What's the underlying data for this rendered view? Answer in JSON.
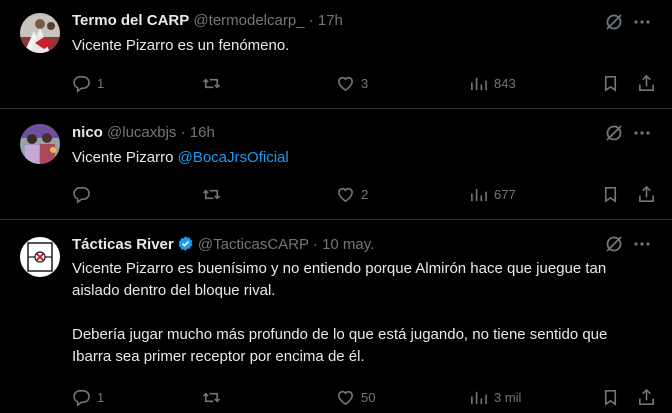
{
  "tweets": [
    {
      "name": "Termo del CARP",
      "handle": "@termodelcarp_",
      "separator": "·",
      "time": "17h",
      "text": "Vicente Pizarro es un fenómeno.",
      "replies": "1",
      "retweets": "",
      "likes": "3",
      "views": "843"
    },
    {
      "name": "nico",
      "handle": "@lucaxbjs",
      "separator": "·",
      "time": "16h",
      "text_prefix": "Vicente Pizarro ",
      "mention": "@BocaJrsOficial",
      "replies": "",
      "retweets": "",
      "likes": "2",
      "views": "677"
    },
    {
      "name": "Tácticas River",
      "handle": "@TacticasCARP",
      "separator": "·",
      "time": "10 may.",
      "text_line1": "Vicente Pizarro es buenísimo y no entiendo porque Almirón hace que juegue tan aislado dentro del bloque rival.",
      "text_line2": "Debería jugar mucho más profundo de lo que está jugando, no tiene sentido que Ibarra sea primer receptor por encima de él.",
      "replies": "1",
      "retweets": "",
      "likes": "50",
      "views": "3 mil"
    }
  ],
  "icons": {
    "reply": "reply-icon",
    "retweet": "retweet-icon",
    "like": "heart-icon",
    "views": "views-icon",
    "bookmark": "bookmark-icon",
    "share": "share-icon",
    "grok": "grok-icon",
    "more": "more-icon"
  },
  "colors": {
    "background": "#000000",
    "text": "#e7e9ea",
    "secondary": "#71767b",
    "mention": "#1d9bf0",
    "verified": "#1d9bf0",
    "divider": "#2f3336"
  }
}
